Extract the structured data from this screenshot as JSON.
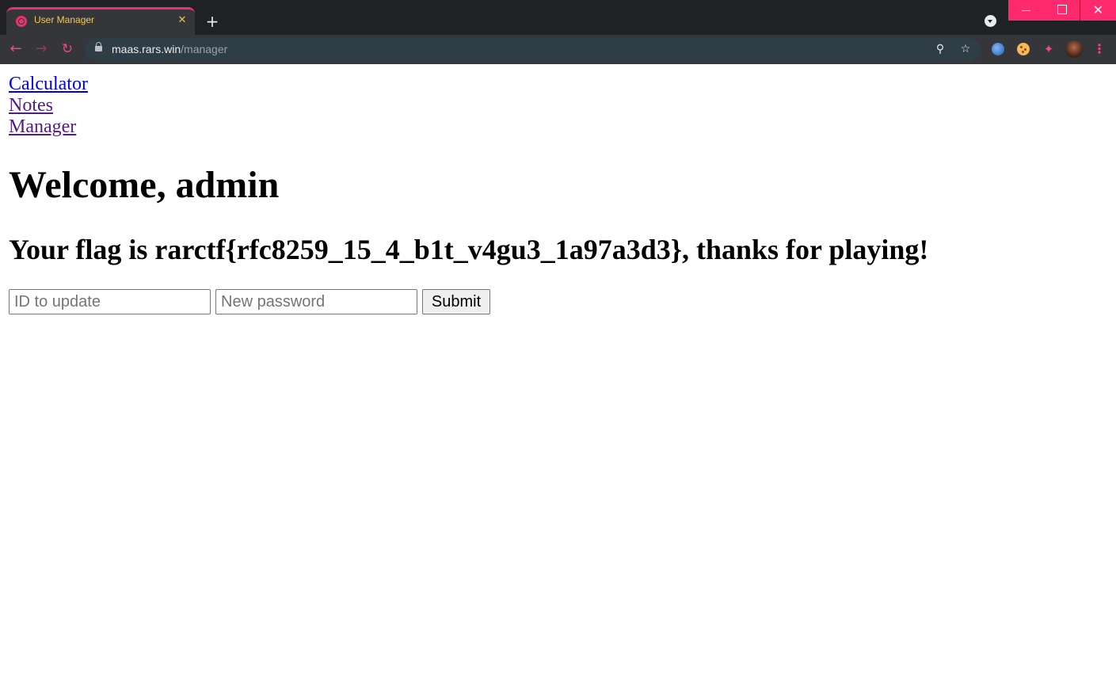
{
  "browser": {
    "tab": {
      "title": "User Manager",
      "close_glyph": "✕",
      "favicon": "globe-icon"
    },
    "new_tab_glyph": "+",
    "address_bar": {
      "host": "maas.rars.win",
      "path": "/manager",
      "secure_icon": "lock-icon"
    },
    "toolbar_icons": [
      "back-arrow-icon",
      "forward-arrow-icon",
      "reload-icon",
      "zoom-icon",
      "bookmark-star-icon",
      "globe-extension-icon",
      "cookie-extension-icon",
      "puzzle-extensions-icon",
      "profile-avatar",
      "kebab-menu-icon"
    ],
    "window_controls": [
      "minimize",
      "maximize",
      "close"
    ],
    "accent_color": "#ff2a6d",
    "tab_title_color": "#f6c94a"
  },
  "nav": {
    "links": [
      {
        "label": "Calculator",
        "visited": false
      },
      {
        "label": "Notes",
        "visited": true
      },
      {
        "label": "Manager",
        "visited": true
      }
    ]
  },
  "main": {
    "heading": "Welcome, admin",
    "flag_message": "Your flag is rarctf{rfc8259_15_4_b1t_v4gu3_1a97a3d3}, thanks for playing!"
  },
  "form": {
    "id_field": {
      "placeholder": "ID to update",
      "value": ""
    },
    "password_field": {
      "placeholder": "New password",
      "value": ""
    },
    "submit_label": "Submit"
  }
}
